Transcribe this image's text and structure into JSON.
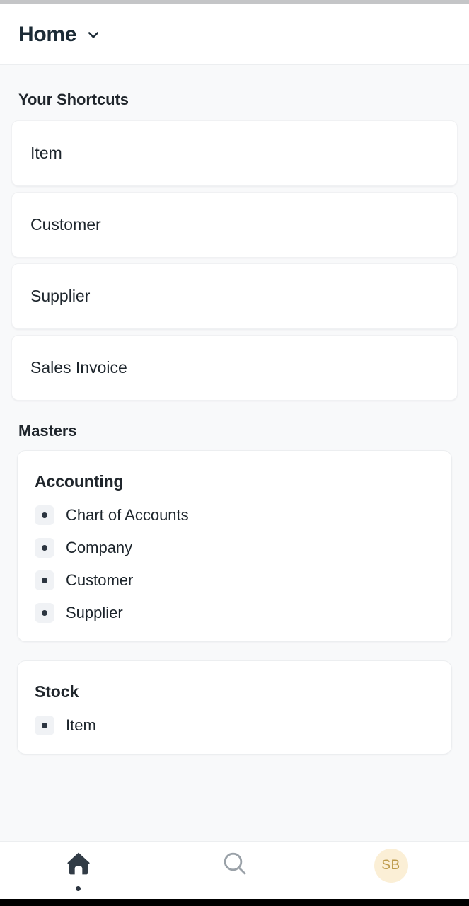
{
  "header": {
    "title": "Home",
    "chevron_icon": "chevron-down-icon"
  },
  "shortcuts": {
    "section_title": "Your Shortcuts",
    "items": [
      {
        "label": "Item"
      },
      {
        "label": "Customer"
      },
      {
        "label": "Supplier"
      },
      {
        "label": "Sales Invoice"
      }
    ]
  },
  "masters": {
    "section_title": "Masters",
    "groups": [
      {
        "title": "Accounting",
        "items": [
          {
            "label": "Chart of Accounts",
            "icon": "bullet-dot-icon"
          },
          {
            "label": "Company",
            "icon": "bullet-dot-icon"
          },
          {
            "label": "Customer",
            "icon": "bullet-dot-icon"
          },
          {
            "label": "Supplier",
            "icon": "bullet-dot-icon"
          }
        ]
      },
      {
        "title": "Stock",
        "items": [
          {
            "label": "Item",
            "icon": "bullet-dot-icon"
          }
        ]
      }
    ]
  },
  "bottom_nav": {
    "items": [
      {
        "name": "home",
        "icon": "home-icon",
        "active": true
      },
      {
        "name": "search",
        "icon": "search-icon",
        "active": false
      },
      {
        "name": "profile",
        "icon": "avatar",
        "initials": "SB",
        "active": false
      }
    ]
  },
  "colors": {
    "page_background": "#f8f9fa",
    "card_background": "#ffffff",
    "text_primary": "#1d252c",
    "heading": "#20262c",
    "nav_icon_active": "#2c3540",
    "nav_icon_inactive": "#9aa1a8",
    "avatar_background": "#fbefd6",
    "avatar_text": "#bd9a4a",
    "badge_background": "#f0f2f5"
  }
}
